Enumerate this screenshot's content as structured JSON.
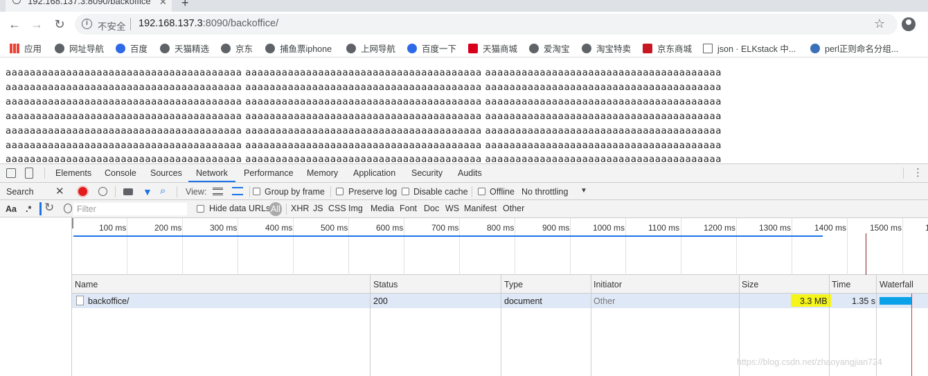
{
  "browser": {
    "tab_title": "192.168.137.3:8090/backoffice",
    "new_tab_label": "+",
    "security_label": "不安全",
    "url_host": "192.168.137.3",
    "url_rest": ":8090/backoffice/"
  },
  "bookmarks": [
    {
      "label": "应用",
      "icon": "apps-grid-icon"
    },
    {
      "label": "网址导航",
      "icon": "globe-icon"
    },
    {
      "label": "百度",
      "icon": "baidu-paw-icon"
    },
    {
      "label": "天猫精选",
      "icon": "globe-icon"
    },
    {
      "label": "京东",
      "icon": "globe-icon"
    },
    {
      "label": "捕鱼票iphone",
      "icon": "globe-icon"
    },
    {
      "label": "上网导航",
      "icon": "globe-icon"
    },
    {
      "label": "百度一下",
      "icon": "baidu-paw-icon"
    },
    {
      "label": "天猫商城",
      "icon": "tmall-icon"
    },
    {
      "label": "爱淘宝",
      "icon": "globe-icon"
    },
    {
      "label": "淘宝特卖",
      "icon": "globe-icon"
    },
    {
      "label": "京东商城",
      "icon": "jd-icon"
    },
    {
      "label": "json · ELKstack 中...",
      "icon": "book-icon"
    },
    {
      "label": "perl正则命名分组...",
      "icon": "perl-icon"
    }
  ],
  "page": {
    "lines": [
      "aaaaaaaaaaaaaaaaaaaaaaaaaaaaaaaaaaaaaaa aaaaaaaaaaaaaaaaaaaaaaaaaaaaaaaaaaaaaaa aaaaaaaaaaaaaaaaaaaaaaaaaaaaaaaaaaaaaaa",
      "aaaaaaaaaaaaaaaaaaaaaaaaaaaaaaaaaaaaaaa aaaaaaaaaaaaaaaaaaaaaaaaaaaaaaaaaaaaaaa aaaaaaaaaaaaaaaaaaaaaaaaaaaaaaaaaaaaaaa",
      "aaaaaaaaaaaaaaaaaaaaaaaaaaaaaaaaaaaaaaa aaaaaaaaaaaaaaaaaaaaaaaaaaaaaaaaaaaaaaa aaaaaaaaaaaaaaaaaaaaaaaaaaaaaaaaaaaaaaa",
      "aaaaaaaaaaaaaaaaaaaaaaaaaaaaaaaaaaaaaaa aaaaaaaaaaaaaaaaaaaaaaaaaaaaaaaaaaaaaaa aaaaaaaaaaaaaaaaaaaaaaaaaaaaaaaaaaaaaaa",
      "aaaaaaaaaaaaaaaaaaaaaaaaaaaaaaaaaaaaaaa aaaaaaaaaaaaaaaaaaaaaaaaaaaaaaaaaaaaaaa aaaaaaaaaaaaaaaaaaaaaaaaaaaaaaaaaaaaaaa",
      "aaaaaaaaaaaaaaaaaaaaaaaaaaaaaaaaaaaaaaa aaaaaaaaaaaaaaaaaaaaaaaaaaaaaaaaaaaaaaa aaaaaaaaaaaaaaaaaaaaaaaaaaaaaaaaaaaaaaa",
      "aaaaaaaaaaaaaaaaaaaaaaaaaaaaaaaaaaaaaaa aaaaaaaaaaaaaaaaaaaaaaaaaaaaaaaaaaaaaaa aaaaaaaaaaaaaaaaaaaaaaaaaaaaaaaaaaaaaaa"
    ]
  },
  "devtools": {
    "tabs": [
      "Elements",
      "Console",
      "Sources",
      "Network",
      "Performance",
      "Memory",
      "Application",
      "Security",
      "Audits"
    ],
    "selected_tab": "Network",
    "search_label": "Search",
    "aa_label": "Aa",
    "regex_label": ".*",
    "view_label": "View:",
    "group_by_frame": "Group by frame",
    "preserve_log": "Preserve log",
    "disable_cache": "Disable cache",
    "offline": "Offline",
    "throttling": "No throttling",
    "filter_placeholder": "Filter",
    "hide_data_urls": "Hide data URLs",
    "filter_types": [
      "All",
      "XHR",
      "JS",
      "CSS",
      "Img",
      "Media",
      "Font",
      "Doc",
      "WS",
      "Manifest",
      "Other"
    ],
    "timeline_ticks": [
      "100 ms",
      "200 ms",
      "300 ms",
      "400 ms",
      "500 ms",
      "600 ms",
      "700 ms",
      "800 ms",
      "900 ms",
      "1000 ms",
      "1100 ms",
      "1200 ms",
      "1300 ms",
      "1400 ms",
      "1500 ms",
      "1"
    ],
    "columns": [
      "Name",
      "Status",
      "Type",
      "Initiator",
      "Size",
      "Time",
      "Waterfall"
    ],
    "rows": [
      {
        "name": "backoffice/",
        "status": "200",
        "type": "document",
        "initiator": "Other",
        "size": "3.3 MB",
        "time": "1.35 s"
      }
    ],
    "highlight_color": "#f5f51a",
    "accent_color": "#1a73e8"
  },
  "watermark": "https://blog.csdn.net/zhaoyangjian724"
}
